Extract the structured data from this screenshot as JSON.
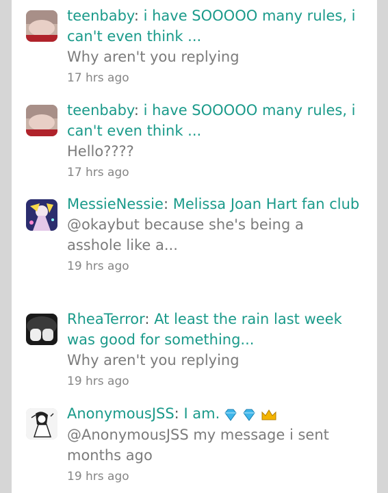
{
  "feed": {
    "items": [
      {
        "avatar_icon": "user-avatar-icon",
        "username": "teenbaby",
        "topic": "i have SOOOOO many rules, i can't even think ...",
        "message": "Why aren't you replying",
        "time": "17 hrs ago"
      },
      {
        "avatar_icon": "user-avatar-icon",
        "username": "teenbaby",
        "topic": "i have SOOOOO many rules, i can't even think ...",
        "message": "Hello????",
        "time": "17 hrs ago"
      },
      {
        "avatar_icon": "user-avatar-icon",
        "username": "MessieNessie",
        "topic": "Melissa Joan Hart fan club",
        "message": "@okaybut because she's being a asshole like a...",
        "time": "19 hrs ago"
      },
      {
        "avatar_icon": "user-avatar-icon",
        "username": "RheaTerror",
        "topic": "At least the rain last week was good for something...",
        "message": "Why aren't you replying",
        "time": "19 hrs ago"
      },
      {
        "avatar_icon": "user-avatar-icon",
        "username": "AnonymousJSS",
        "topic": "I am.",
        "badge_icons": [
          "diamond-icon",
          "diamond-icon",
          "crown-icon"
        ],
        "message": "@AnonymousJSS my message i sent months ago",
        "time": "19 hrs ago"
      }
    ]
  },
  "colors": {
    "link": "#1a9a8a",
    "message": "#7b7b7b",
    "time": "#858585",
    "background": "#d6d6d6",
    "panel": "#ffffff"
  }
}
